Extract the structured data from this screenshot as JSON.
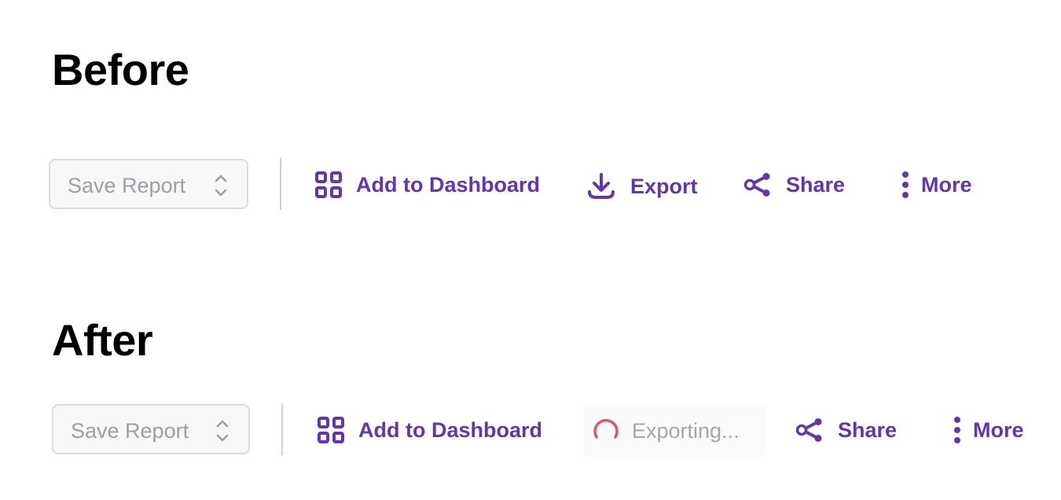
{
  "sections": {
    "before_title": "Before",
    "after_title": "After"
  },
  "before_toolbar": {
    "save_report": "Save Report",
    "add_to_dashboard": "Add to Dashboard",
    "export": "Export",
    "share": "Share",
    "more": "More"
  },
  "after_toolbar": {
    "save_report": "Save Report",
    "add_to_dashboard": "Add to Dashboard",
    "exporting": "Exporting...",
    "share": "Share",
    "more": "More"
  },
  "icons": {
    "save_select": "chevron-up-down-icon",
    "dashboard": "grid-icon",
    "export": "download-icon",
    "share": "share-icon",
    "more": "vertical-dots-icon",
    "exporting": "loading-spinner-icon"
  },
  "colors": {
    "accent": "#6236ae",
    "muted_text": "#9e9ea6",
    "select_background": "#f7f7f8",
    "select_border": "#dcdcdf",
    "spinner": "#e05562",
    "heading": "#000000"
  }
}
